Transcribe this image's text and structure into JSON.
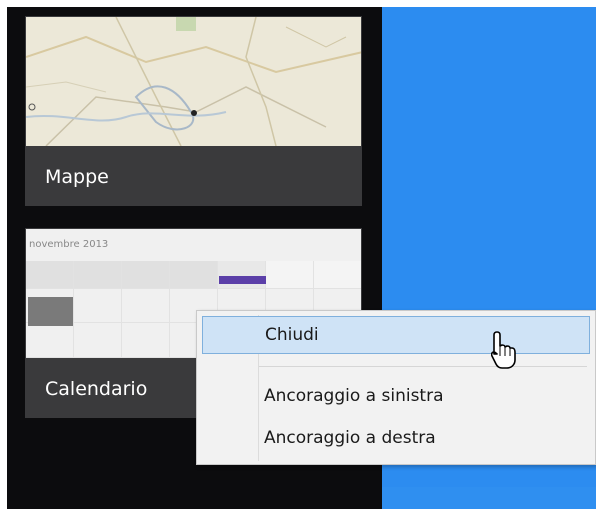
{
  "tiles": [
    {
      "label": "Mappe",
      "icon": "map-thumbnail"
    },
    {
      "label": "Calendario",
      "icon": "calendar-thumbnail",
      "month_text": "novembre 2013"
    }
  ],
  "context_menu": {
    "items": [
      {
        "label": "Chiudi",
        "highlighted": true
      },
      {
        "label": "Ancoraggio a sinistra",
        "highlighted": false
      },
      {
        "label": "Ancoraggio a destra",
        "highlighted": false
      }
    ]
  },
  "colors": {
    "panel": "#0c0c0e",
    "desktop": "#2c8cf0",
    "menu_highlight": "#cfe3f6"
  }
}
